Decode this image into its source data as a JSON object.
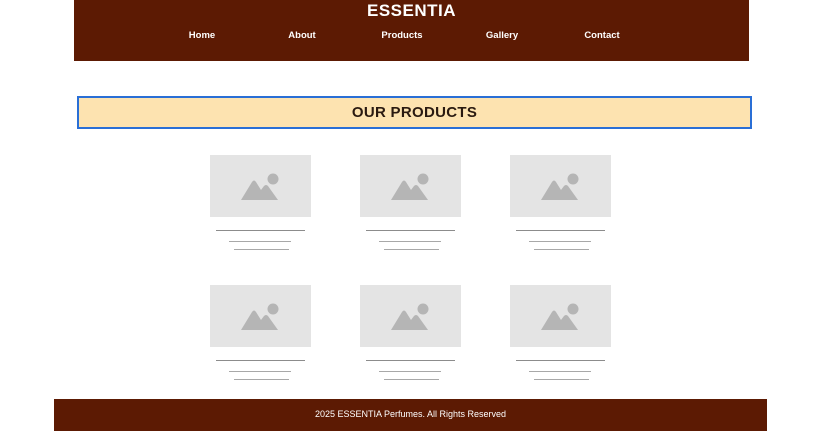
{
  "header": {
    "site_title": "ESSENTIA",
    "nav": [
      {
        "label": "Home"
      },
      {
        "label": "About"
      },
      {
        "label": "Products"
      },
      {
        "label": "Gallery"
      },
      {
        "label": "Contact"
      }
    ]
  },
  "section": {
    "title": "OUR PRODUCTS"
  },
  "products": [
    {
      "image_icon": "image-placeholder-icon"
    },
    {
      "image_icon": "image-placeholder-icon"
    },
    {
      "image_icon": "image-placeholder-icon"
    },
    {
      "image_icon": "image-placeholder-icon"
    },
    {
      "image_icon": "image-placeholder-icon"
    },
    {
      "image_icon": "image-placeholder-icon"
    }
  ],
  "footer": {
    "text": "2025 ESSENTIA Perfumes. All Rights Reserved"
  },
  "colors": {
    "brand": "#5c1a03",
    "banner_background": "#fde3b0",
    "banner_border": "#2a6fd6",
    "placeholder": "#e4e4e4",
    "placeholder_icon": "#b5b5b5"
  }
}
